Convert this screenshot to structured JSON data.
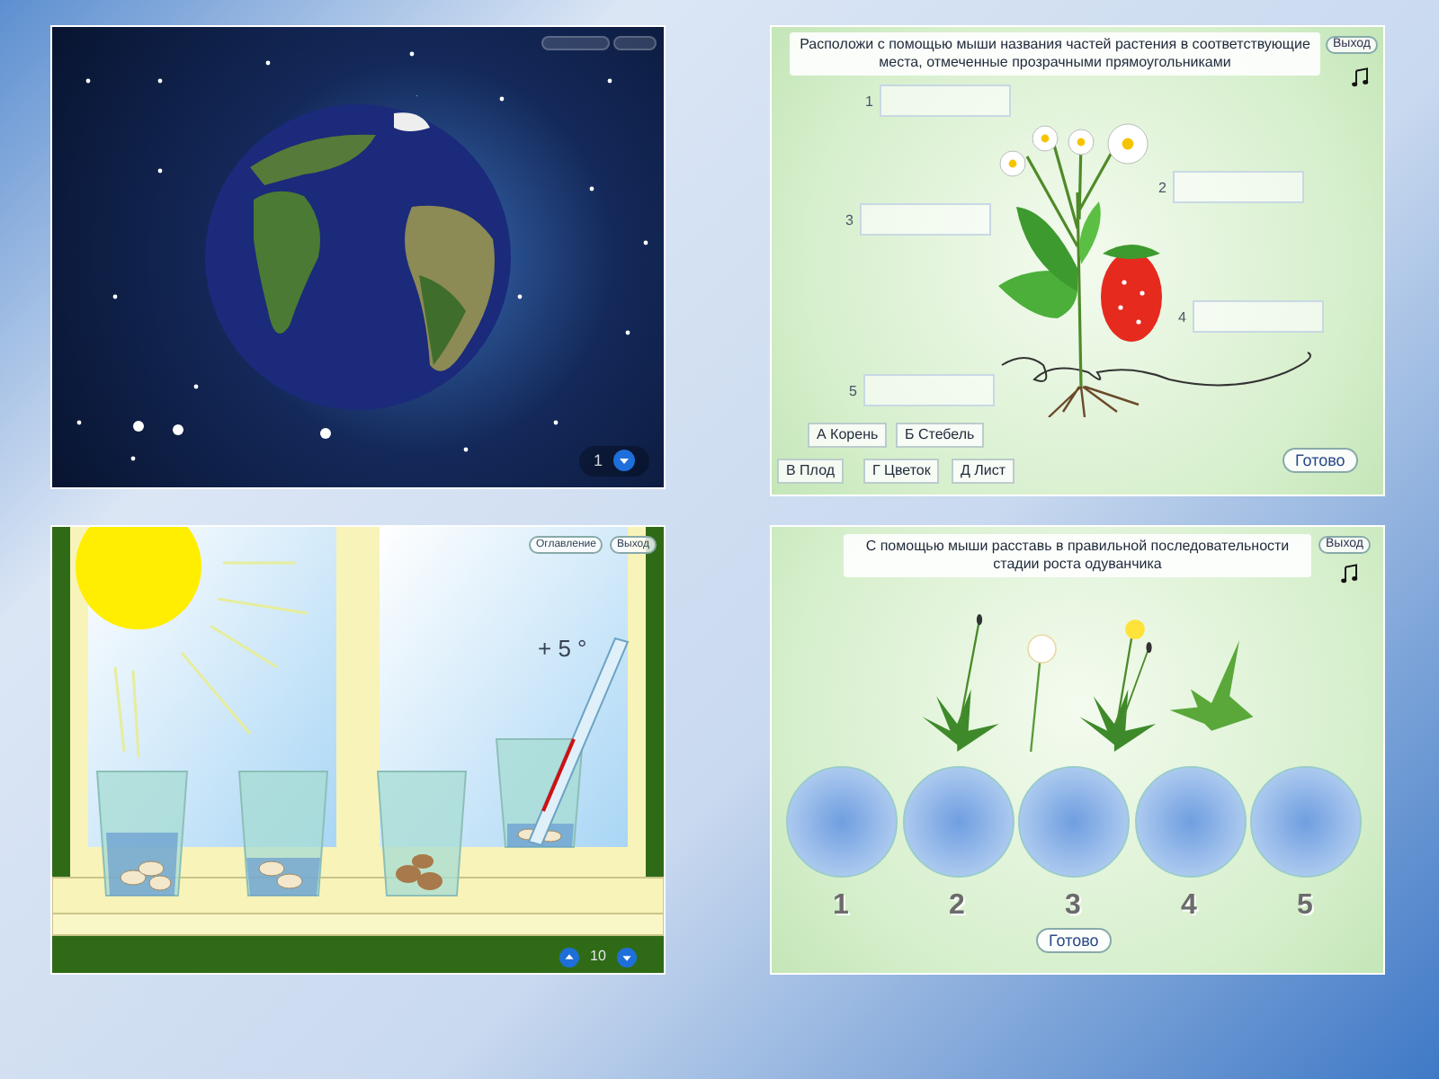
{
  "earth_panel": {
    "page_number": "1"
  },
  "strawberry_panel": {
    "instruction": "Расположи с помощью мыши названия частей растения в соответствующие места, отмеченные прозрачными прямоугольниками",
    "exit_button": "Выход",
    "slot_numbers": [
      "1",
      "2",
      "3",
      "4",
      "5"
    ],
    "word_cards": [
      "А Корень",
      "Б Стебель",
      "В Плод",
      "Г Цветок",
      "Д Лист"
    ],
    "done_button": "Готово"
  },
  "window_panel": {
    "buttons": [
      "Оглавление",
      "Выход"
    ],
    "temperature": "+ 5 °",
    "page_number": "10"
  },
  "dandelion_panel": {
    "instruction": "С помощью мыши расставь в правильной последовательности стадии роста одуванчика",
    "exit_button": "Выход",
    "circle_numbers": [
      "1",
      "2",
      "3",
      "4",
      "5"
    ],
    "done_button": "Готово"
  }
}
